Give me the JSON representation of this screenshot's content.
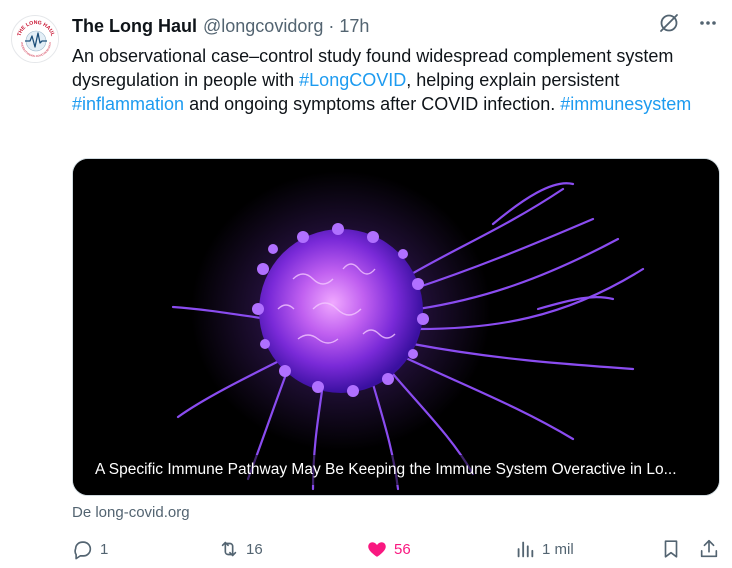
{
  "account": {
    "display_name": "The Long Haul",
    "handle": "@longcovidorg",
    "separator": "·",
    "timestamp": "17h",
    "avatar_text_top": "THE LONG HAUL",
    "avatar_text_bottom": "UNDERSTANDING COVID RESEARCH"
  },
  "tweet": {
    "text_before_tag1": "An observational case–control study found widespread complement system dysregulation in people with ",
    "hashtag1": "#LongCOVID",
    "text_between": ", helping explain persistent ",
    "hashtag2": "#inflammation",
    "text_after_tag2": " and ongoing symptoms after COVID infection. ",
    "hashtag3": "#immunesystem"
  },
  "link_card": {
    "title": "A Specific Immune Pathway May Be Keeping the Immune System Overactive in Lo...",
    "source": "De long-covid.org"
  },
  "actions": {
    "replies": "1",
    "reposts": "16",
    "likes": "56",
    "views": "1 mil"
  },
  "colors": {
    "accent": "#1d9bf0",
    "like": "#f91880",
    "muted": "#536471",
    "text": "#0f1419"
  },
  "icons": [
    "grok-icon",
    "more-icon",
    "reply-icon",
    "repost-icon",
    "heart-icon",
    "views-icon",
    "bookmark-icon",
    "share-icon"
  ]
}
